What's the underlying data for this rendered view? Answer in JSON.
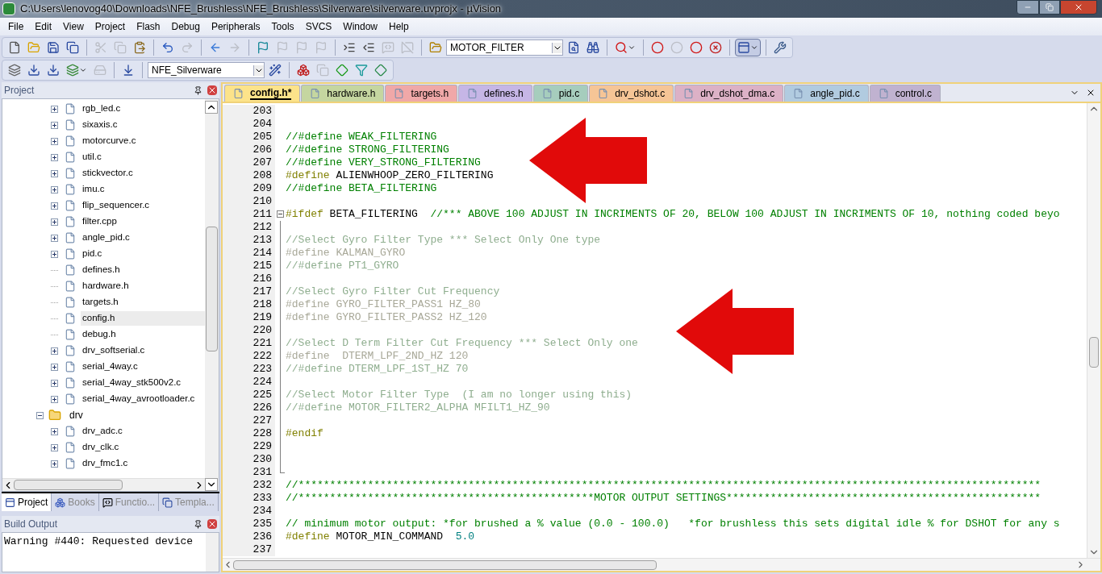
{
  "window": {
    "title": "C:\\Users\\lenovog40\\Downloads\\NFE_Brushless\\NFE_Brushless\\Silverware\\silverware.uvprojx - µVision"
  },
  "menu": [
    "File",
    "Edit",
    "View",
    "Project",
    "Flash",
    "Debug",
    "Peripherals",
    "Tools",
    "SVCS",
    "Window",
    "Help"
  ],
  "toolbars": [
    {
      "items": [
        {
          "kind": "button",
          "disabled": false
        },
        {
          "kind": "button",
          "disabled": false
        },
        {
          "kind": "button",
          "disabled": false
        },
        {
          "kind": "button",
          "disabled": false
        },
        {
          "kind": "separator"
        },
        {
          "kind": "button",
          "disabled": true
        },
        {
          "kind": "button",
          "disabled": true
        },
        {
          "kind": "button",
          "disabled": false
        },
        {
          "kind": "separator"
        },
        {
          "kind": "button",
          "disabled": false
        },
        {
          "kind": "button",
          "disabled": true
        },
        {
          "kind": "separator"
        },
        {
          "kind": "button",
          "disabled": false
        },
        {
          "kind": "button",
          "disabled": true
        },
        {
          "kind": "separator"
        },
        {
          "kind": "button",
          "disabled": false
        },
        {
          "kind": "button",
          "disabled": true
        },
        {
          "kind": "button",
          "disabled": true
        },
        {
          "kind": "button",
          "disabled": true
        },
        {
          "kind": "separator"
        },
        {
          "kind": "button",
          "disabled": false
        },
        {
          "kind": "button",
          "disabled": false
        },
        {
          "kind": "button",
          "disabled": true
        },
        {
          "kind": "button",
          "disabled": true
        },
        {
          "kind": "separator"
        },
        {
          "kind": "button",
          "disabled": false
        },
        {
          "kind": "dropdown",
          "value": "MOTOR_FILTER"
        },
        {
          "kind": "button",
          "disabled": false
        },
        {
          "kind": "button",
          "disabled": false
        },
        {
          "kind": "separator"
        },
        {
          "kind": "menu-button",
          "disabled": false,
          "pressed": false
        },
        {
          "kind": "separator"
        },
        {
          "kind": "button",
          "disabled": false
        },
        {
          "kind": "button",
          "disabled": true
        },
        {
          "kind": "button",
          "disabled": false
        },
        {
          "kind": "button",
          "disabled": false
        },
        {
          "kind": "separator"
        },
        {
          "kind": "menu-button",
          "disabled": false,
          "pressed": true
        },
        {
          "kind": "separator"
        },
        {
          "kind": "button",
          "disabled": false
        }
      ]
    },
    {
      "items": [
        {
          "kind": "button",
          "disabled": false
        },
        {
          "kind": "button",
          "disabled": false
        },
        {
          "kind": "button",
          "disabled": false
        },
        {
          "kind": "menu-button",
          "disabled": false,
          "pressed": false
        },
        {
          "kind": "button",
          "disabled": true
        },
        {
          "kind": "separator"
        },
        {
          "kind": "button",
          "disabled": false
        },
        {
          "kind": "separator"
        },
        {
          "kind": "dropdown",
          "value": "NFE_Silverware"
        },
        {
          "kind": "button",
          "disabled": false
        },
        {
          "kind": "separator"
        },
        {
          "kind": "button",
          "disabled": false
        },
        {
          "kind": "button",
          "disabled": true
        },
        {
          "kind": "button",
          "disabled": false
        },
        {
          "kind": "button",
          "disabled": false
        },
        {
          "kind": "button",
          "disabled": false
        }
      ]
    }
  ],
  "project_panel": {
    "title": "Project",
    "tree": [
      {
        "kind": "file",
        "label": "rgb_led.c",
        "expandable": true,
        "selected": false
      },
      {
        "kind": "file",
        "label": "sixaxis.c",
        "expandable": true,
        "selected": false
      },
      {
        "kind": "file",
        "label": "motorcurve.c",
        "expandable": true,
        "selected": false
      },
      {
        "kind": "file",
        "label": "util.c",
        "expandable": true,
        "selected": false
      },
      {
        "kind": "file",
        "label": "stickvector.c",
        "expandable": true,
        "selected": false
      },
      {
        "kind": "file",
        "label": "imu.c",
        "expandable": true,
        "selected": false
      },
      {
        "kind": "file",
        "label": "flip_sequencer.c",
        "expandable": true,
        "selected": false
      },
      {
        "kind": "file",
        "label": "filter.cpp",
        "expandable": true,
        "selected": false
      },
      {
        "kind": "file",
        "label": "angle_pid.c",
        "expandable": true,
        "selected": false
      },
      {
        "kind": "file",
        "label": "pid.c",
        "expandable": true,
        "selected": false
      },
      {
        "kind": "file",
        "label": "defines.h",
        "expandable": false,
        "selected": false
      },
      {
        "kind": "file",
        "label": "hardware.h",
        "expandable": false,
        "selected": false
      },
      {
        "kind": "file",
        "label": "targets.h",
        "expandable": false,
        "selected": false
      },
      {
        "kind": "file",
        "label": "config.h",
        "expandable": false,
        "selected": true
      },
      {
        "kind": "file",
        "label": "debug.h",
        "expandable": false,
        "selected": false
      },
      {
        "kind": "file",
        "label": "drv_softserial.c",
        "expandable": true,
        "selected": false
      },
      {
        "kind": "file",
        "label": "serial_4way.c",
        "expandable": true,
        "selected": false
      },
      {
        "kind": "file",
        "label": "serial_4way_stk500v2.c",
        "expandable": true,
        "selected": false
      },
      {
        "kind": "file",
        "label": "serial_4way_avrootloader.c",
        "expandable": true,
        "selected": false
      },
      {
        "kind": "folder",
        "label": "drv",
        "expanded": true,
        "selected": false,
        "children": [
          {
            "kind": "file",
            "label": "drv_adc.c",
            "expandable": true,
            "selected": false
          },
          {
            "kind": "file",
            "label": "drv_clk.c",
            "expandable": true,
            "selected": false
          },
          {
            "kind": "file",
            "label": "drv_fmc1.c",
            "expandable": true,
            "selected": false
          }
        ]
      }
    ],
    "tabs": [
      {
        "label": "Project",
        "selected": true
      },
      {
        "label": "Books",
        "selected": false
      },
      {
        "label": "Functio...",
        "selected": false
      },
      {
        "label": "Templa...",
        "selected": false
      }
    ]
  },
  "build_output": {
    "title": "Build Output",
    "text": "Warning #440: Requested device"
  },
  "editor": {
    "tabs": [
      {
        "label": "config.h*",
        "selected": true,
        "color": "#fce38a"
      },
      {
        "label": "hardware.h",
        "selected": false,
        "color": "#c5d6a0"
      },
      {
        "label": "targets.h",
        "selected": false,
        "color": "#f0a8a8"
      },
      {
        "label": "defines.h",
        "selected": false,
        "color": "#c6b6e6"
      },
      {
        "label": "pid.c",
        "selected": false,
        "color": "#a6cdbd"
      },
      {
        "label": "drv_dshot.c",
        "selected": false,
        "color": "#f6c596"
      },
      {
        "label": "drv_dshot_dma.c",
        "selected": false,
        "color": "#dcb1c6"
      },
      {
        "label": "angle_pid.c",
        "selected": false,
        "color": "#b1cbe0"
      },
      {
        "label": "control.c",
        "selected": false,
        "color": "#c0b2d0"
      }
    ],
    "lines": [
      {
        "number": "203"
      },
      {
        "number": "204"
      },
      {
        "number": "205",
        "segments": [
          {
            "kind": "comment",
            "text": "//#define WEAK_FILTERING"
          }
        ]
      },
      {
        "number": "206",
        "segments": [
          {
            "kind": "comment",
            "text": "//#define STRONG_FILTERING"
          }
        ]
      },
      {
        "number": "207",
        "segments": [
          {
            "kind": "comment",
            "text": "//#define VERY_STRONG_FILTERING"
          }
        ]
      },
      {
        "number": "208",
        "segments": [
          {
            "kind": "directive",
            "text": "#define"
          },
          {
            "kind": "plain",
            "text": " ALIENWHOOP_ZERO_FILTERING"
          }
        ]
      },
      {
        "number": "209",
        "segments": [
          {
            "kind": "comment",
            "text": "//#define BETA_FILTERING"
          }
        ]
      },
      {
        "number": "210"
      },
      {
        "number": "211",
        "expanded": true,
        "segments": [
          {
            "kind": "directive",
            "text": "#ifdef"
          },
          {
            "kind": "plain",
            "text": " BETA_FILTERING  "
          },
          {
            "kind": "comment",
            "text": "//*** ABOVE 100 ADJUST IN INCRIMENTS OF 20, BELOW 100 ADJUST IN INCRIMENTS OF 10, nothing coded beyo"
          }
        ],
        "children": [
          {
            "number": "212"
          },
          {
            "number": "213",
            "segments": [
              {
                "kind": "inactive_comment",
                "text": "//Select Gyro Filter Type *** Select Only One type"
              }
            ]
          },
          {
            "number": "214",
            "segments": [
              {
                "kind": "inactive",
                "text": "#define KALMAN_GYRO"
              }
            ]
          },
          {
            "number": "215",
            "segments": [
              {
                "kind": "inactive_comment",
                "text": "//#define PT1_GYRO"
              }
            ]
          },
          {
            "number": "216"
          },
          {
            "number": "217",
            "segments": [
              {
                "kind": "inactive_comment",
                "text": "//Select Gyro Filter Cut Frequency"
              }
            ]
          },
          {
            "number": "218",
            "segments": [
              {
                "kind": "inactive",
                "text": "#define GYRO_FILTER_PASS1 HZ_80"
              }
            ]
          },
          {
            "number": "219",
            "segments": [
              {
                "kind": "inactive",
                "text": "#define GYRO_FILTER_PASS2 HZ_120"
              }
            ]
          },
          {
            "number": "220"
          },
          {
            "number": "221",
            "segments": [
              {
                "kind": "inactive_comment",
                "text": "//Select D Term Filter Cut Frequency *** Select Only one"
              }
            ]
          },
          {
            "number": "222",
            "segments": [
              {
                "kind": "inactive",
                "text": "#define  DTERM_LPF_2ND_HZ 120"
              }
            ]
          },
          {
            "number": "223",
            "segments": [
              {
                "kind": "inactive_comment",
                "text": "//#define DTERM_LPF_1ST_HZ 70"
              }
            ]
          },
          {
            "number": "224"
          },
          {
            "number": "225",
            "segments": [
              {
                "kind": "inactive_comment",
                "text": "//Select Motor Filter Type  (I am no longer using this)"
              }
            ]
          },
          {
            "number": "226",
            "segments": [
              {
                "kind": "inactive_comment",
                "text": "//#define MOTOR_FILTER2_ALPHA MFILT1_HZ_90"
              }
            ]
          },
          {
            "number": "227"
          },
          {
            "number": "228",
            "segments": [
              {
                "kind": "directive",
                "text": "#endif"
              }
            ]
          },
          {
            "number": "229"
          },
          {
            "number": "230"
          },
          {
            "number": "231"
          }
        ]
      },
      {
        "number": "232",
        "segments": [
          {
            "kind": "comment",
            "text": "//**********************************************************************************************************************"
          }
        ]
      },
      {
        "number": "233",
        "segments": [
          {
            "kind": "comment",
            "text": "//***********************************************MOTOR OUTPUT SETTINGS**************************************************"
          }
        ]
      },
      {
        "number": "234"
      },
      {
        "number": "235",
        "segments": [
          {
            "kind": "comment",
            "text": "// minimum motor output: *for brushed a % value (0.0 - 100.0)   *for brushless this sets digital idle % for DSHOT for any s"
          }
        ]
      },
      {
        "number": "236",
        "segments": [
          {
            "kind": "directive",
            "text": "#define"
          },
          {
            "kind": "plain",
            "text": " MOTOR_MIN_COMMAND  "
          },
          {
            "kind": "number",
            "text": "5.0"
          }
        ]
      },
      {
        "number": "237"
      }
    ]
  }
}
